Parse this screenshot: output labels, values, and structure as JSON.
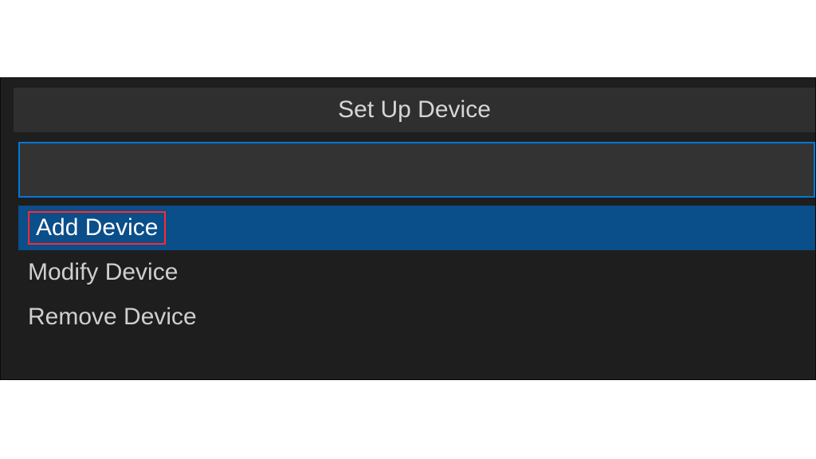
{
  "panel": {
    "title": "Set Up Device",
    "search_value": "",
    "items": [
      {
        "label": "Add Device",
        "selected": true,
        "highlighted": true
      },
      {
        "label": "Modify Device",
        "selected": false,
        "highlighted": false
      },
      {
        "label": "Remove Device",
        "selected": false,
        "highlighted": false
      }
    ]
  },
  "colors": {
    "accent": "#0078d7",
    "selection": "#0a4e8a",
    "highlight_box": "#ff2a2a",
    "panel_bg": "#1e1e1e",
    "titlebar_bg": "#2f2f2f"
  }
}
